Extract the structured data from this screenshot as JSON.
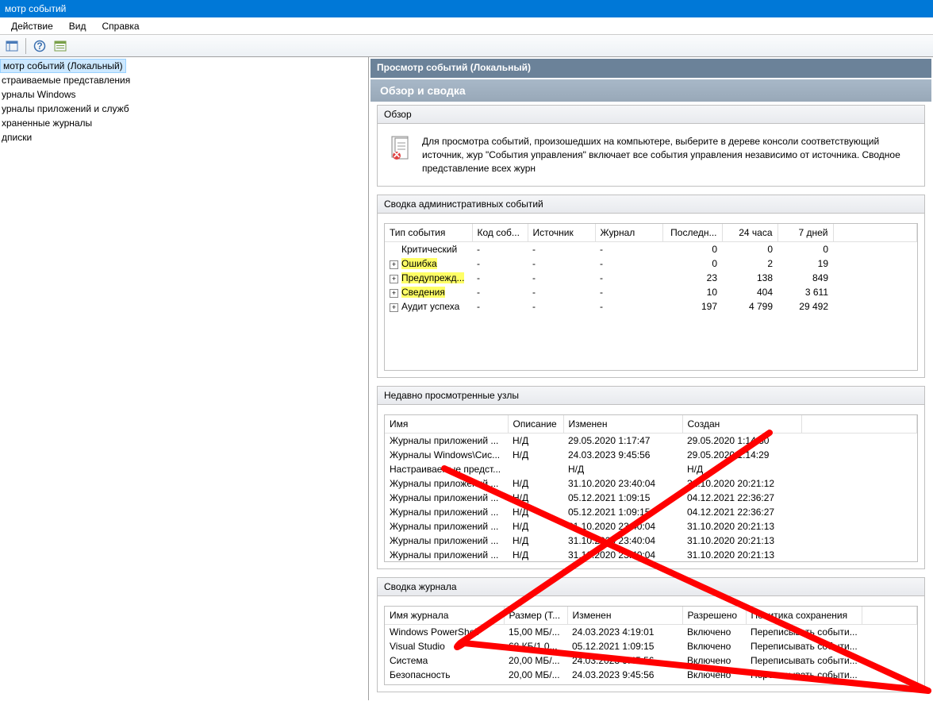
{
  "titlebar": "мотр событий",
  "menu": {
    "action": "Действие",
    "view": "Вид",
    "help": "Справка"
  },
  "tree": {
    "root": "мотр событий (Локальный)",
    "items": [
      "страиваемые представления",
      "урналы Windows",
      "урналы приложений и служб",
      "храненные журналы",
      "дписки"
    ]
  },
  "content": {
    "header": "Просмотр событий (Локальный)",
    "title": "Обзор и сводка"
  },
  "overview": {
    "label": "Обзор",
    "text": "Для просмотра событий, произошедших на компьютере, выберите в дереве консоли соответствующий источник, жур \"События управления\" включает все события управления независимо от источника. Сводное представление всех журн"
  },
  "summary": {
    "label": "Сводка административных событий",
    "headers": {
      "type": "Тип события",
      "code": "Код соб...",
      "source": "Источник",
      "journal": "Журнал",
      "last": "Последн...",
      "h24": "24 часа",
      "d7": "7 дней"
    },
    "rows": [
      {
        "type": "Критический",
        "code": "-",
        "source": "-",
        "journal": "-",
        "last": "0",
        "h24": "0",
        "d7": "0",
        "expandable": false,
        "highlight": false
      },
      {
        "type": "Ошибка",
        "code": "-",
        "source": "-",
        "journal": "-",
        "last": "0",
        "h24": "2",
        "d7": "19",
        "expandable": true,
        "highlight": true
      },
      {
        "type": "Предупрежд...",
        "code": "-",
        "source": "-",
        "journal": "-",
        "last": "23",
        "h24": "138",
        "d7": "849",
        "expandable": true,
        "highlight": true
      },
      {
        "type": "Сведения",
        "code": "-",
        "source": "-",
        "journal": "-",
        "last": "10",
        "h24": "404",
        "d7": "3 611",
        "expandable": true,
        "highlight": true
      },
      {
        "type": "Аудит успеха",
        "code": "-",
        "source": "-",
        "journal": "-",
        "last": "197",
        "h24": "4 799",
        "d7": "29 492",
        "expandable": true,
        "highlight": false
      }
    ]
  },
  "recent": {
    "label": "Недавно просмотренные узлы",
    "headers": {
      "name": "Имя",
      "desc": "Описание",
      "modified": "Изменен",
      "created": "Создан"
    },
    "rows": [
      {
        "name": "Журналы приложений ...",
        "desc": "Н/Д",
        "modified": "29.05.2020 1:17:47",
        "created": "29.05.2020 1:14:30"
      },
      {
        "name": "Журналы Windows\\Сис...",
        "desc": "Н/Д",
        "modified": "24.03.2023 9:45:56",
        "created": "29.05.2020 1:14:29"
      },
      {
        "name": "Настраиваемые предст...",
        "desc": "",
        "modified": "Н/Д",
        "created": "Н/Д"
      },
      {
        "name": "Журналы приложений ...",
        "desc": "Н/Д",
        "modified": "31.10.2020 23:40:04",
        "created": "31.10.2020 20:21:12"
      },
      {
        "name": "Журналы приложений ...",
        "desc": "Н/Д",
        "modified": "05.12.2021 1:09:15",
        "created": "04.12.2021 22:36:27"
      },
      {
        "name": "Журналы приложений ...",
        "desc": "Н/Д",
        "modified": "05.12.2021 1:09:15",
        "created": "04.12.2021 22:36:27"
      },
      {
        "name": "Журналы приложений ...",
        "desc": "Н/Д",
        "modified": "31.10.2020 23:40:04",
        "created": "31.10.2020 20:21:13"
      },
      {
        "name": "Журналы приложений ...",
        "desc": "Н/Д",
        "modified": "31.10.2020 23:40:04",
        "created": "31.10.2020 20:21:13"
      },
      {
        "name": "Журналы приложений ...",
        "desc": "Н/Д",
        "modified": "31.10.2020 23:40:04",
        "created": "31.10.2020 20:21:13"
      }
    ]
  },
  "journal": {
    "label": "Сводка журнала",
    "headers": {
      "name": "Имя журнала",
      "size": "Размер (Т...",
      "modified": "Изменен",
      "enabled": "Разрешено",
      "policy": "Политика сохранения"
    },
    "rows": [
      {
        "name": "Windows PowerShell",
        "size": "15,00 МБ/...",
        "modified": "24.03.2023 4:19:01",
        "enabled": "Включено",
        "policy": "Переписывать событи..."
      },
      {
        "name": "Visual Studio",
        "size": "68 КБ/1,0...",
        "modified": "05.12.2021 1:09:15",
        "enabled": "Включено",
        "policy": "Переписывать событи..."
      },
      {
        "name": "Система",
        "size": "20,00 МБ/...",
        "modified": "24.03.2023 9:45:56",
        "enabled": "Включено",
        "policy": "Переписывать событи..."
      },
      {
        "name": "Безопасность",
        "size": "20,00 МБ/...",
        "modified": "24.03.2023 9:45:56",
        "enabled": "Включено",
        "policy": "Переписывать событи..."
      }
    ]
  }
}
